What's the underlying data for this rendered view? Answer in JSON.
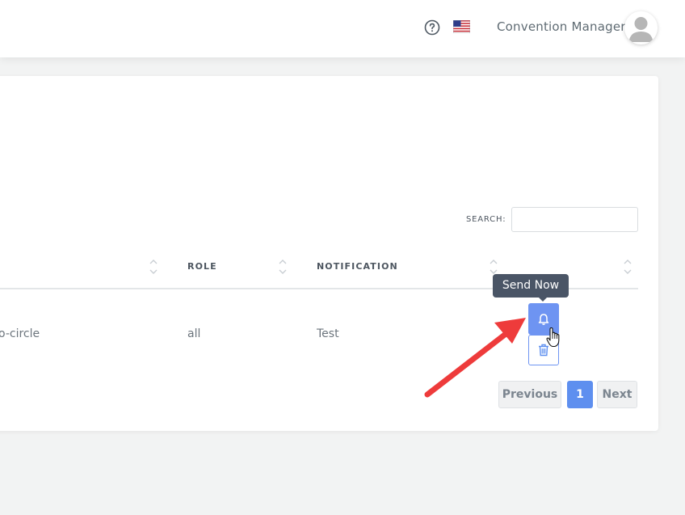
{
  "header": {
    "user_name": "Convention Manager",
    "icons": {
      "help": "question-circle-icon",
      "language": "us-flag-icon",
      "avatar": "user-avatar-icon"
    }
  },
  "table": {
    "search_label": "SEARCH:",
    "search_value": "",
    "columns": [
      "",
      "ROLE",
      "NOTIFICATION",
      ""
    ],
    "rows": [
      {
        "first": "o-circle",
        "role": "all",
        "notification": "Test"
      }
    ]
  },
  "actions": {
    "tooltip": "Send Now",
    "send_icon": "bell-icon",
    "delete_icon": "trash-icon"
  },
  "pagination": {
    "previous": "Previous",
    "current": "1",
    "next": "Next"
  },
  "colors": {
    "accent": "#5e8fef",
    "tooltip_bg": "#4a5566",
    "annotation": "#ee3b3b"
  }
}
